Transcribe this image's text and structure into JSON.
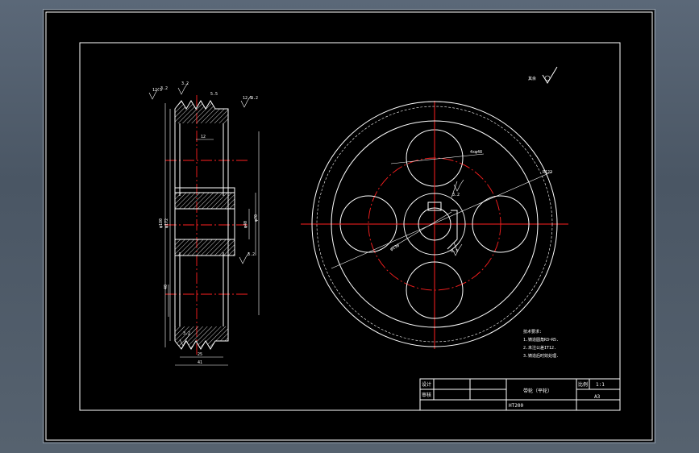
{
  "drawing": {
    "roughness_note": "其余",
    "side_view_dims": {
      "top_labels": [
        "12.5",
        "5.5",
        "12.5"
      ],
      "groove_width": "12",
      "dia_left_1": "φ180",
      "dia_left_2": "φ172",
      "bore_dia": "φ40",
      "hub_dia": "φ70",
      "web_len": "40",
      "width_inner": "25",
      "width_total": "41",
      "roughness_vals": [
        "3.2",
        "3.2",
        "3.2",
        "3.2",
        "3.2"
      ]
    },
    "front_view_dims": {
      "hole_spacing": "4xφ48",
      "outer_radius": "R122",
      "pcd": "φ130",
      "key_dims": [
        "3.2",
        "6.3"
      ]
    },
    "tech_requirements": {
      "title": "技术要求:",
      "items": [
        "1.铸造圆角R3~R5.",
        "2.未注公差IT12.",
        "3.铸造后时效处理."
      ]
    }
  },
  "title_block": {
    "label_design": "设计",
    "label_check": "审核",
    "part_name": "带轮（平轮）",
    "code": "HT200",
    "label_ratio": "比例",
    "ratio_value": "1:1",
    "sheet": "A3"
  }
}
